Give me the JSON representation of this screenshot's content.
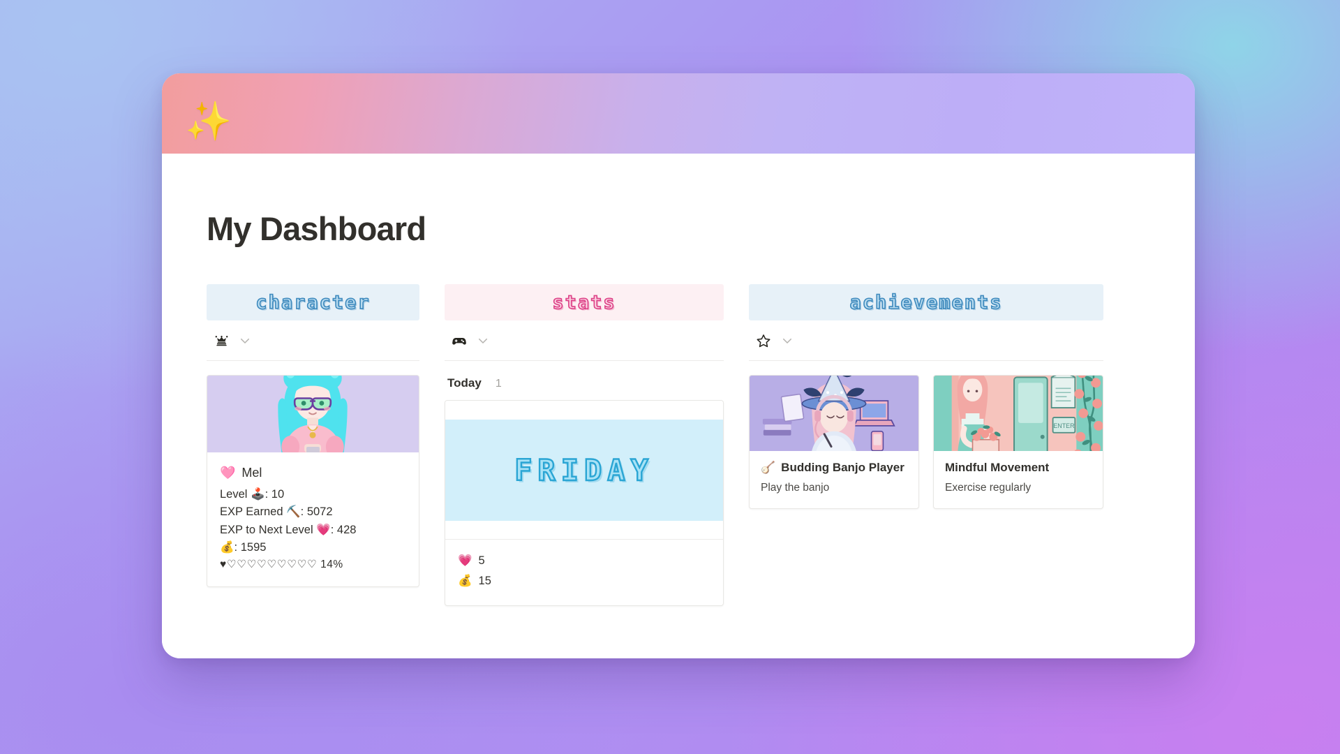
{
  "page": {
    "cover_emoji": "✨",
    "title": "My Dashboard"
  },
  "colors": {
    "header_blue_bg": "#e7f1f8",
    "header_pink_bg": "#fdf0f3",
    "header_blue_text": "#3d89bd",
    "header_pink_text": "#dd3f86",
    "banner_blue": "#d2effa",
    "banner_text": "#2aa5d4",
    "avatar_bg": "#d6cdf0",
    "page_bg": "#ffffff"
  },
  "columns": [
    {
      "id": "character",
      "header": "character",
      "header_style": "blue",
      "view_icon": "crown-icon",
      "chevron": "chevron-down-icon"
    },
    {
      "id": "stats",
      "header": "stats",
      "header_style": "pink",
      "view_icon": "gamepad-icon",
      "chevron": "chevron-down-icon"
    },
    {
      "id": "achievements",
      "header": "achievements",
      "header_style": "blue",
      "view_icon": "star-icon",
      "chevron": "chevron-down-icon"
    }
  ],
  "character": {
    "avatar_alt": "pixel-anime-avatar-cyan-hair-glasses-pink-sweater",
    "name_emoji": "🩷",
    "name": "Mel",
    "level_label": "Level",
    "level_emoji": "🕹️",
    "level_value": "10",
    "exp_earned_label": "EXP Earned",
    "exp_earned_emoji": "⛏️",
    "exp_earned_value": "5072",
    "exp_next_label": "EXP to Next Level",
    "exp_next_emoji": "💗",
    "exp_next_value": "428",
    "coins_emoji": "💰",
    "coins_value": "1595",
    "progress_hearts_filled": "♥",
    "progress_hearts_empty": "♡♡♡♡♡♡♡♡♡",
    "progress_percent": "14%"
  },
  "stats": {
    "group_label": "Today",
    "group_count": "1",
    "entry": {
      "banner_text": "FRIDAY",
      "rows": [
        {
          "emoji": "💗",
          "value": "5"
        },
        {
          "emoji": "💰",
          "value": "15"
        }
      ]
    }
  },
  "achievements": [
    {
      "art_alt": "illustration-girl-with-party-hat-books-laptop-purple",
      "emoji": "🪕",
      "title": "Budding Banjo Player",
      "description": "Play the banjo"
    },
    {
      "art_alt": "illustration-girl-carrying-flower-bag-shopfront-roses",
      "emoji": "",
      "title": "Mindful Movement",
      "description": "Exercise regularly"
    }
  ]
}
